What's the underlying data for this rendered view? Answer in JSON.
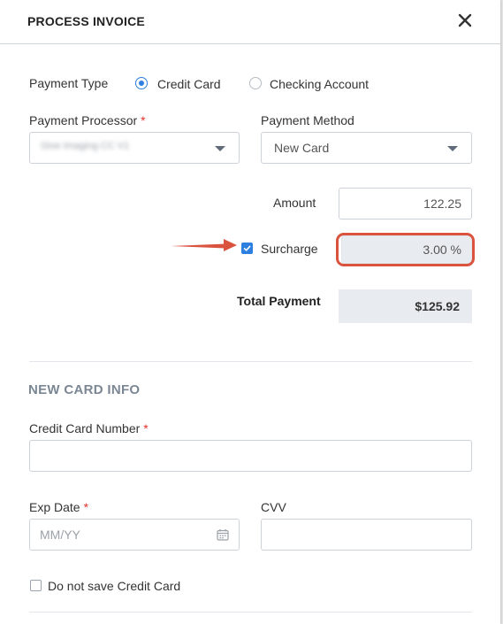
{
  "modal": {
    "title": "PROCESS INVOICE"
  },
  "payment_type": {
    "label": "Payment Type",
    "options": [
      {
        "label": "Credit Card",
        "selected": true
      },
      {
        "label": "Checking Account",
        "selected": false
      }
    ]
  },
  "payment_processor": {
    "label": "Payment Processor",
    "required_mark": "*",
    "value": "Give Imaging CC V1"
  },
  "payment_method": {
    "label": "Payment Method",
    "value": "New Card"
  },
  "amount": {
    "label": "Amount",
    "value": "122.25"
  },
  "surcharge": {
    "label": "Surcharge",
    "checked": true,
    "value": "3.00 %"
  },
  "total_payment": {
    "label": "Total Payment",
    "value": "$125.92"
  },
  "new_card_info": {
    "section_title": "NEW CARD INFO",
    "card_number_label": "Credit Card Number",
    "required_mark": "*",
    "exp_date_label": "Exp Date",
    "exp_date_placeholder": "MM/YY",
    "cvv_label": "CVV",
    "save_card_label": "Do not save Credit Card",
    "save_card_checked": false
  },
  "colors": {
    "accent": "#2d7fe0",
    "annotation": "#d9533f",
    "required": "#e0342b"
  }
}
